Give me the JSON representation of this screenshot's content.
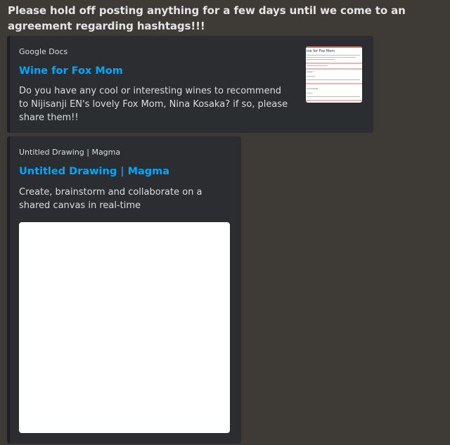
{
  "message": {
    "text": "Please hold off posting anything for a few days until we come to an agreement regarding hashtags!!!"
  },
  "embeds": [
    {
      "provider": "Google Docs",
      "title": "Wine for Fox Mom",
      "description": "Do you have any cool or interesting wines to recommend to Nijisanji EN's lovely Fox Mom, Nina Kosaka? if so, please share them!!",
      "thumbnail": {
        "title": "ine for Fox Mom",
        "field_label": "ine(s) *",
        "comments_label": "Comments"
      }
    },
    {
      "provider": "Untitled Drawing | Magma",
      "title": "Untitled Drawing | Magma",
      "description": "Create, brainstorm and collaborate on a shared canvas in real-time"
    }
  ],
  "colors": {
    "background": "#3e3a35",
    "embed_bg": "#2b2d31",
    "link": "#00a8fc",
    "text": "#dbdee1"
  }
}
